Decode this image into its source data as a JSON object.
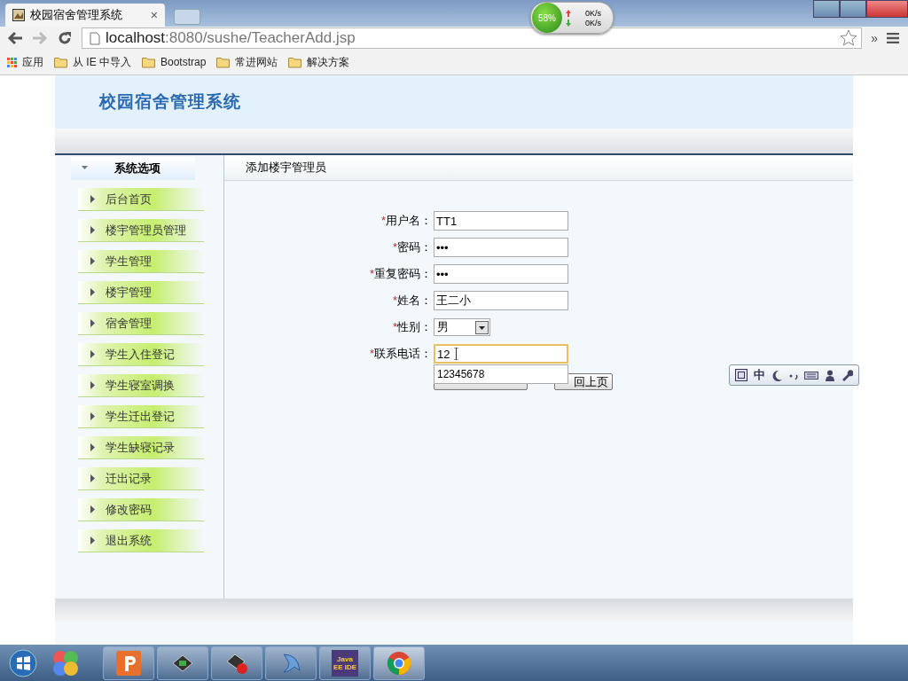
{
  "browser": {
    "tab": {
      "title": "校园宿舍管理系统",
      "close": "×"
    },
    "address": {
      "host": "localhost",
      "rest": ":8080/sushe/TeacherAdd.jsp"
    },
    "overflow": "»",
    "bookmarks": [
      {
        "kind": "apps",
        "label": "应用"
      },
      {
        "kind": "folder",
        "label": "从 IE 中导入"
      },
      {
        "kind": "folder",
        "label": "Bootstrap"
      },
      {
        "kind": "folder",
        "label": "常进网站"
      },
      {
        "kind": "folder",
        "label": "解决方案"
      }
    ]
  },
  "net_monitor": {
    "percent": "58%",
    "up": "0K/s",
    "down": "0K/s"
  },
  "page": {
    "site_title": "校园宿舍管理系统",
    "sidebar": {
      "heading": "系统选项",
      "expanded": true,
      "items": [
        {
          "label": "后台首页"
        },
        {
          "label": "楼宇管理员管理"
        },
        {
          "label": "学生管理"
        },
        {
          "label": "楼宇管理"
        },
        {
          "label": "宿舍管理"
        },
        {
          "label": "学生入住登记"
        },
        {
          "label": "学生寝室调换"
        },
        {
          "label": "学生迁出登记"
        },
        {
          "label": "学生缺寝记录"
        },
        {
          "label": "迁出记录"
        },
        {
          "label": "修改密码"
        },
        {
          "label": "退出系统"
        }
      ]
    },
    "content_title": "添加楼宇管理员",
    "form": {
      "fields": [
        {
          "kind": "text",
          "mark": "*",
          "label": "用户名：",
          "value": "TT1",
          "focused": false
        },
        {
          "kind": "text",
          "mark": "*",
          "label": "密码：",
          "value": "•••",
          "focused": false
        },
        {
          "kind": "text",
          "mark": "*",
          "label": "重复密码：",
          "value": "•••",
          "focused": false
        },
        {
          "kind": "text",
          "mark": "*",
          "label": "姓名：",
          "value": "王二小",
          "focused": false
        },
        {
          "kind": "select",
          "mark": "*",
          "label": "性别：",
          "value": "男",
          "focused": false
        },
        {
          "kind": "text",
          "mark": "*",
          "label": "联系电话：",
          "value": "12",
          "focused": true
        }
      ],
      "suggestions": [
        "12345678"
      ],
      "buttons": [
        {
          "kind": "submit"
        },
        {
          "kind": "back",
          "label": "回上页"
        }
      ]
    }
  },
  "ime_toolbar": {
    "mode": "中"
  },
  "taskbar": {
    "apps": [
      {
        "kind": "start"
      },
      {
        "kind": "orb"
      },
      {
        "kind": "p"
      },
      {
        "kind": "term"
      },
      {
        "kind": "rec"
      },
      {
        "kind": "dolphin"
      },
      {
        "kind": "ide",
        "label": "Java EE IDE"
      },
      {
        "kind": "chrome"
      }
    ]
  }
}
